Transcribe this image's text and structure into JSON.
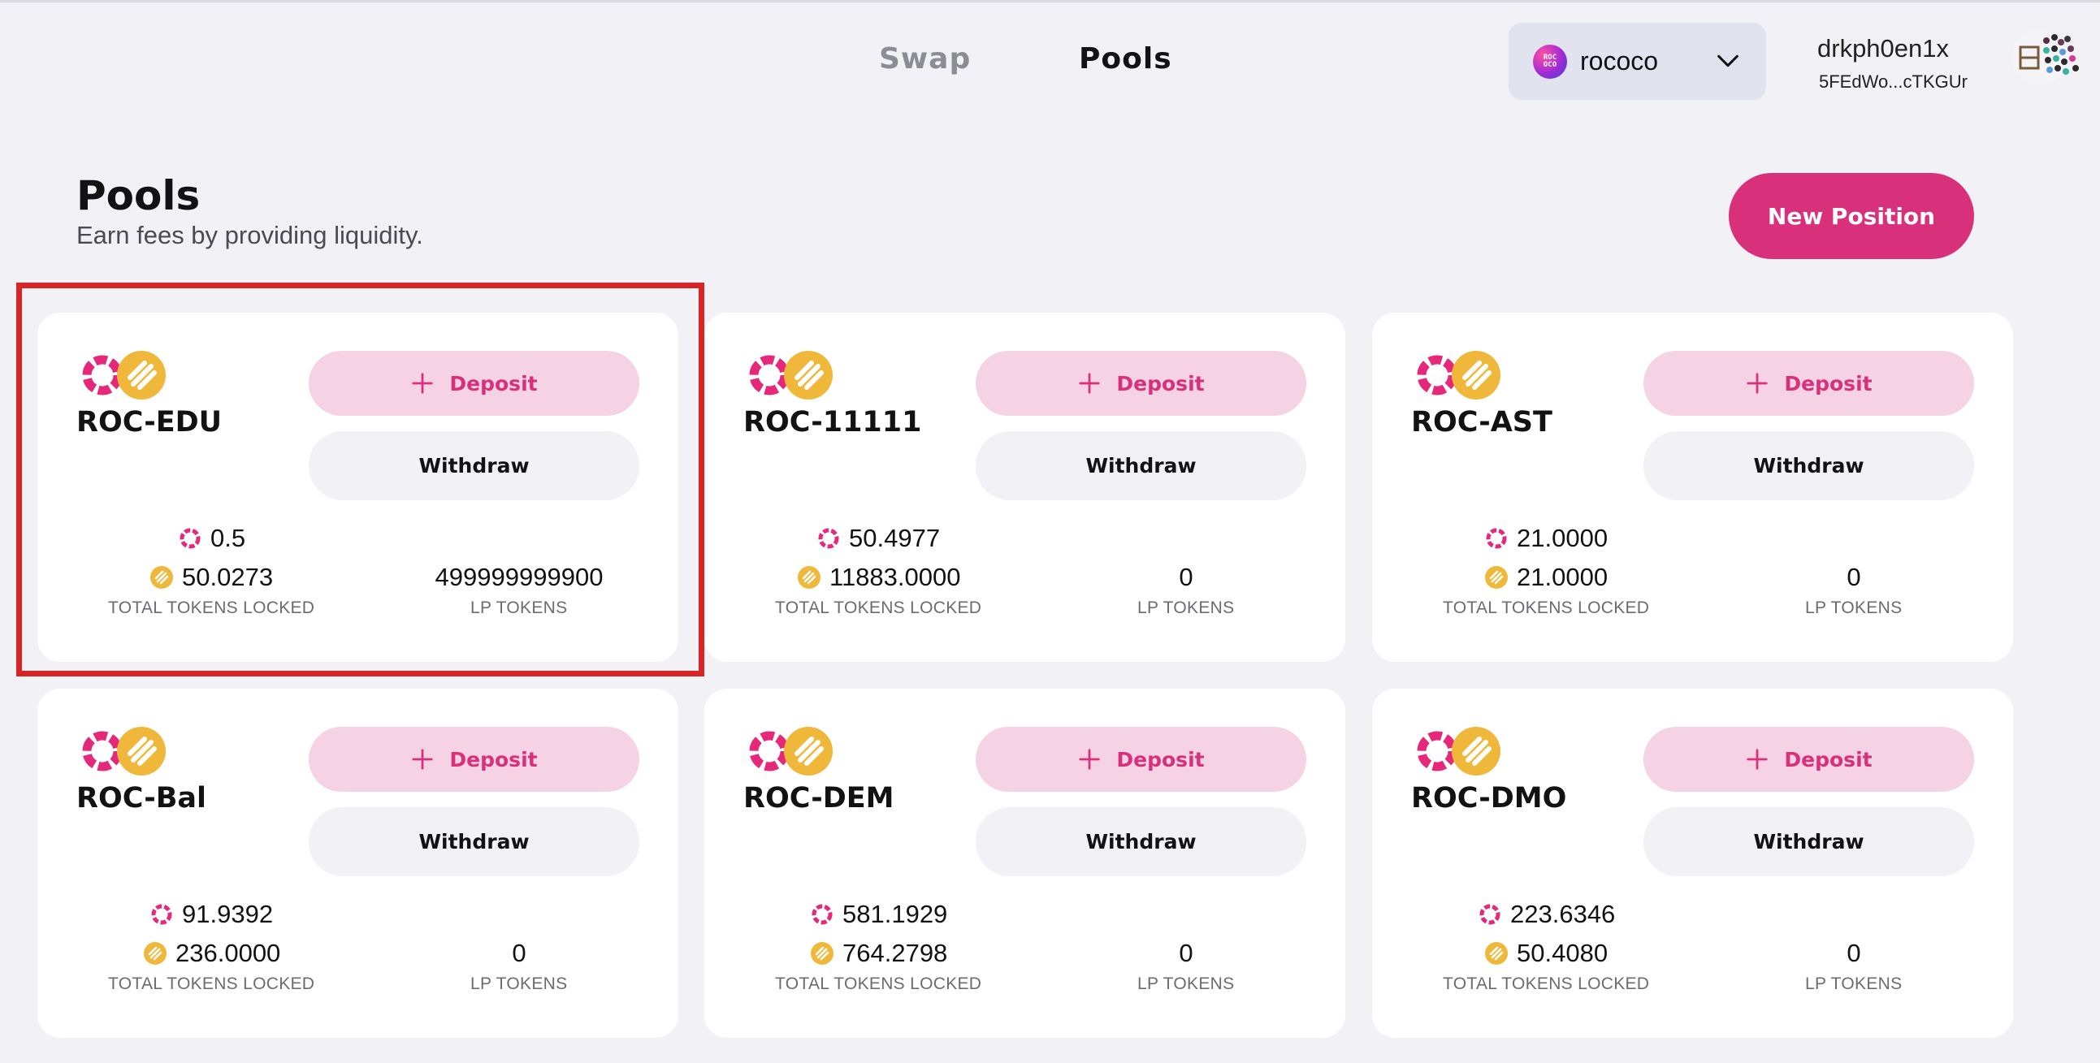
{
  "header": {
    "nav": [
      {
        "label": "Swap"
      },
      {
        "label": "Pools"
      }
    ],
    "network": {
      "label": "rococo",
      "logo_text": "ROC\nOCO",
      "icon": "chevron-down-icon"
    },
    "account": {
      "name": "drkph0en1x",
      "address": "5FEdWo...cTKGUr"
    }
  },
  "page": {
    "title": "Pools",
    "subtitle": "Earn fees by providing liquidity.",
    "new_position_label": "New Position"
  },
  "labels": {
    "deposit": "Deposit",
    "withdraw": "Withdraw",
    "total_tokens_locked": "TOTAL TOKENS LOCKED",
    "lp_tokens": "LP TOKENS"
  },
  "colors": {
    "accent": "#d8307b",
    "roc": "#e6287a",
    "asset": "#f0b83a",
    "highlight": "#d82424"
  },
  "pools": [
    {
      "name": "ROC-EDU",
      "token_a": "0.5",
      "token_b": "50.0273",
      "lp": "499999999900"
    },
    {
      "name": "ROC-11111",
      "token_a": "50.4977",
      "token_b": "11883.0000",
      "lp": "0"
    },
    {
      "name": "ROC-AST",
      "token_a": "21.0000",
      "token_b": "21.0000",
      "lp": "0"
    },
    {
      "name": "ROC-Bal",
      "token_a": "91.9392",
      "token_b": "236.0000",
      "lp": "0"
    },
    {
      "name": "ROC-DEM",
      "token_a": "581.1929",
      "token_b": "764.2798",
      "lp": "0"
    },
    {
      "name": "ROC-DMO",
      "token_a": "223.6346",
      "token_b": "50.4080",
      "lp": "0"
    }
  ]
}
